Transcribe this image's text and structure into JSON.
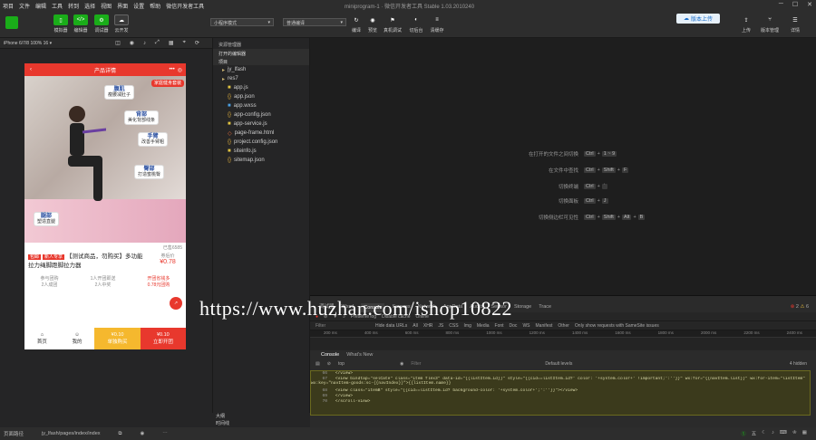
{
  "menu": [
    "项目",
    "文件",
    "编辑",
    "工具",
    "转到",
    "选择",
    "视图",
    "界面",
    "设置",
    "帮助",
    "微信开发者工具"
  ],
  "window": {
    "title": "miniprogram-1 · 微信开发者工具 Stable 1.03.2010240"
  },
  "toolbar": {
    "buttons": [
      "模拟器",
      "编辑器",
      "调试器",
      "云开发"
    ],
    "mode_select": "小程序模式",
    "compile_select": "普通编译",
    "right_buttons": [
      "编译",
      "预览",
      "真机调试",
      "切后台",
      "清缓存"
    ],
    "cloud_label": "版本上传",
    "far_right": [
      "上传",
      "版本管理",
      "详情"
    ]
  },
  "simulator": {
    "device": "iPhone 6/7/8 100% 16 ▾"
  },
  "phone": {
    "nav_title": "产品详情",
    "labels": [
      {
        "title": "腹肌",
        "sub": "瘦腰减肚子"
      },
      {
        "title": "背部",
        "sub": "美化背部线条"
      },
      {
        "title": "手臂",
        "sub": "改善手臂粗"
      },
      {
        "title": "臀部",
        "sub": "打造蜜桃臀"
      },
      {
        "title": "腿部",
        "sub": "塑造直腿"
      }
    ],
    "top_tag": "家庭健身套装",
    "sold": "已售6585",
    "tag1": "包邮",
    "tag2": "新人专享",
    "title": "【测试商品，勿购买】多功能拉力绳脚蹬脚拉力器",
    "side_price_label": "券后价",
    "side_price": "¥0.78",
    "groups": [
      {
        "a": "参与团购",
        "b": "2人成团"
      },
      {
        "a": "1人开团即送",
        "b": "2人中奖"
      },
      {
        "a": "开团省钱多",
        "b": "0.78元团购"
      }
    ],
    "tabs": [
      "首页",
      "我的"
    ],
    "buy1_price": "¥0.10",
    "buy1_label": "单独购买",
    "buy2_price": "¥0.10",
    "buy2_label": "立即开团"
  },
  "explorer": {
    "header": "资源管理器",
    "section_open": "打开的编辑器",
    "section_root": "项目",
    "files": [
      "jy_lfash",
      "res7",
      "app.js",
      "app.json",
      "app.wxss",
      "app-config.json",
      "app-service.js",
      "page-frame.html",
      "project.config.json",
      "siteinfo.js",
      "sitemap.json"
    ]
  },
  "shortcuts": [
    {
      "text": "在打开的文件之间切换",
      "keys": [
        "Ctrl",
        "1 ~ 9"
      ]
    },
    {
      "text": "在文件中查找",
      "keys": [
        "Ctrl",
        "Shift",
        "F"
      ]
    },
    {
      "text": "切换终端",
      "keys": [
        "Ctrl",
        "`"
      ]
    },
    {
      "text": "切换面板",
      "keys": [
        "Ctrl",
        "J"
      ]
    },
    {
      "text": "切换侧边栏可见性",
      "keys": [
        "Ctrl",
        "Shift",
        "Alt",
        "B"
      ]
    }
  ],
  "devtools": {
    "tabs": [
      "调试器",
      "Wxml",
      "Console",
      "Sources",
      "Network",
      "AppData",
      "Audits",
      "Sensor",
      "Storage",
      "Trace"
    ],
    "network_row": [
      "Preserve log",
      "Disable cache",
      "Online"
    ],
    "filters": [
      "Hide data URLs",
      "All",
      "XHR",
      "JS",
      "CSS",
      "Img",
      "Media",
      "Font",
      "Doc",
      "WS",
      "Manifest",
      "Other",
      "Only show requests with SameSite issues"
    ],
    "timeline": [
      "200 ms",
      "400 ms",
      "600 ms",
      "800 ms",
      "1000 ms",
      "1200 ms",
      "1400 ms",
      "1600 ms",
      "1800 ms",
      "2000 ms",
      "2200 ms",
      "2400 ms"
    ],
    "console_tabs": [
      "Console",
      "What's New"
    ],
    "console_context": "top",
    "console_filter": "Filter",
    "console_levels": "Default levels",
    "hidden": "4 hidden",
    "errors": "2",
    "warnings": "6",
    "code": [
      {
        "n": "66",
        "t": "        </view>"
      },
      {
        "n": "67",
        "t": "        <view bindtap=\"selCate\" class=\"item flex3\" data-id=\"{{listItem.id}}\" style=\"{{cid==listItem.id?' color: '+system.color+' !important;':''}}\" wx:for=\"{{navItem.list}}\" wx:for-item=\"listItem\" wx:key=\"navItem-goods:sc-{{navIndex}}\">{{listItem.name}}"
      },
      {
        "n": "68",
        "t": "            <view class=\"itemB\" style=\"{{cid==listItem.id? background-color: '+system.color+';':''}}\"></view>"
      },
      {
        "n": "69",
        "t": "        </view>"
      },
      {
        "n": "70",
        "t": "    </scroll-view>"
      }
    ]
  },
  "outline": [
    "大纲",
    "时间线"
  ],
  "status": {
    "path": "页面路径",
    "page": "jy_lfash/pages/index/index",
    "ime": "五"
  },
  "watermark": "https://www.huzhan.com/ishop10822"
}
